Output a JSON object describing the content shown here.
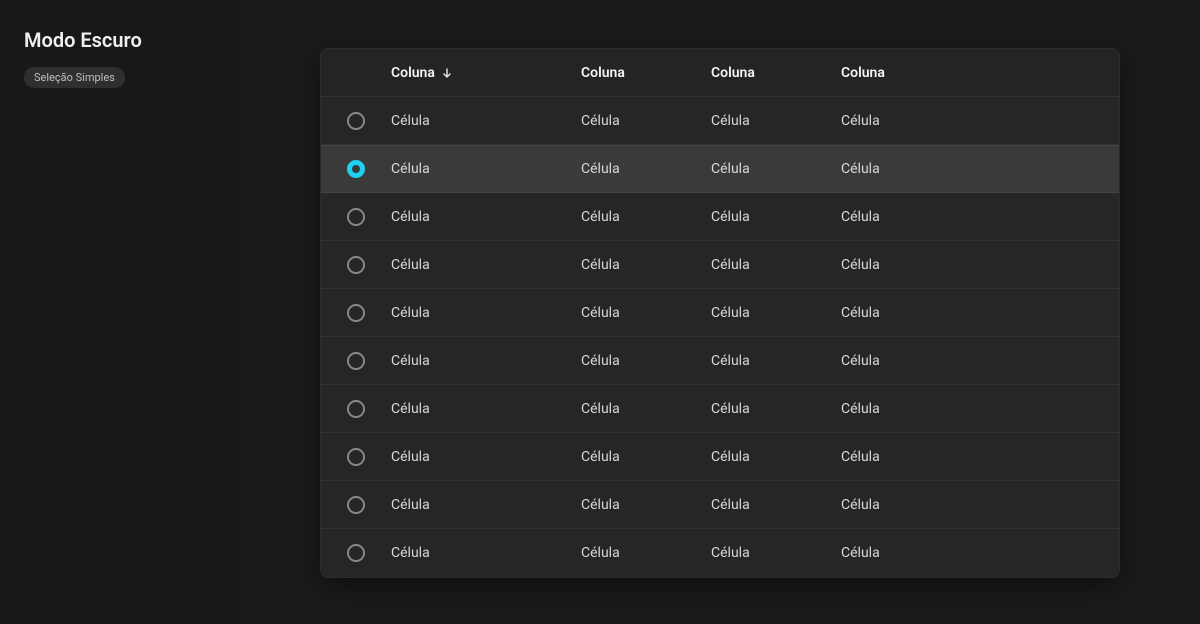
{
  "sidebar": {
    "title": "Modo Escuro",
    "chip_label": "Seleção Simples"
  },
  "table": {
    "columns": [
      "Coluna",
      "Coluna",
      "Coluna",
      "Coluna"
    ],
    "sorted_column_index": 0,
    "rows": [
      {
        "selected": false,
        "cells": [
          "Célula",
          "Célula",
          "Célula",
          "Célula"
        ]
      },
      {
        "selected": true,
        "cells": [
          "Célula",
          "Célula",
          "Célula",
          "Célula"
        ]
      },
      {
        "selected": false,
        "cells": [
          "Célula",
          "Célula",
          "Célula",
          "Célula"
        ]
      },
      {
        "selected": false,
        "cells": [
          "Célula",
          "Célula",
          "Célula",
          "Célula"
        ]
      },
      {
        "selected": false,
        "cells": [
          "Célula",
          "Célula",
          "Célula",
          "Célula"
        ]
      },
      {
        "selected": false,
        "cells": [
          "Célula",
          "Célula",
          "Célula",
          "Célula"
        ]
      },
      {
        "selected": false,
        "cells": [
          "Célula",
          "Célula",
          "Célula",
          "Célula"
        ]
      },
      {
        "selected": false,
        "cells": [
          "Célula",
          "Célula",
          "Célula",
          "Célula"
        ]
      },
      {
        "selected": false,
        "cells": [
          "Célula",
          "Célula",
          "Célula",
          "Célula"
        ]
      },
      {
        "selected": false,
        "cells": [
          "Célula",
          "Célula",
          "Célula",
          "Célula"
        ]
      }
    ]
  }
}
